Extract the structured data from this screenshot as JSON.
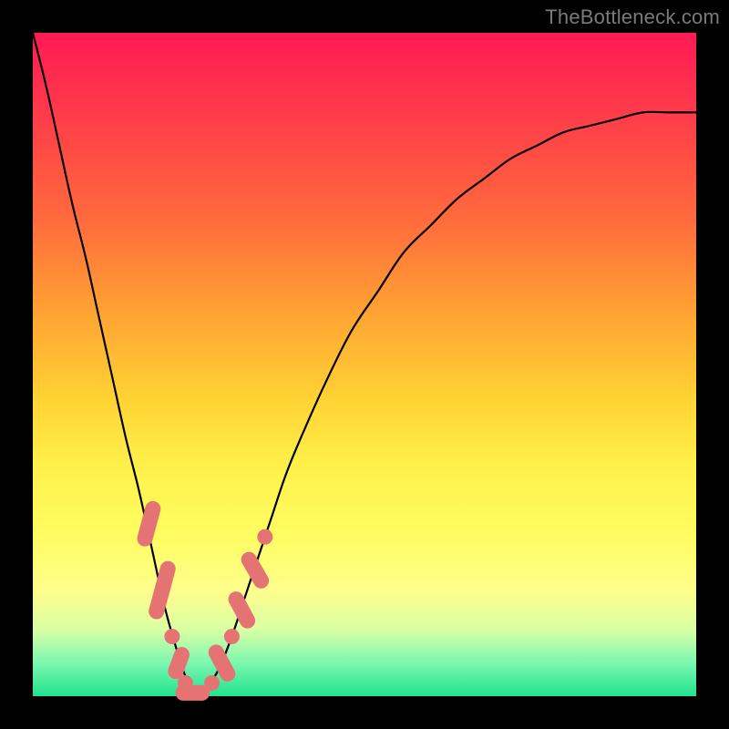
{
  "watermark": "TheBottleneck.com",
  "colors": {
    "frame": "#000000",
    "curve": "#000000",
    "marker": "#e57373",
    "gradient_stops": [
      "#ff1a55",
      "#ff3b4a",
      "#ff6a3c",
      "#ffa233",
      "#ffd233",
      "#fff04a",
      "#fffd62",
      "#fffe8c",
      "#d9ffa3",
      "#7cf7b0",
      "#20e38e"
    ]
  },
  "chart_data": {
    "type": "line",
    "title": "",
    "xlabel": "",
    "ylabel": "",
    "xlim": [
      0,
      100
    ],
    "ylim": [
      0,
      100
    ],
    "x": [
      0,
      2,
      4,
      6,
      8,
      10,
      12,
      14,
      16,
      18,
      20,
      22,
      23,
      24,
      25,
      26,
      28,
      30,
      32,
      34,
      36,
      38,
      40,
      44,
      48,
      52,
      56,
      60,
      64,
      68,
      72,
      76,
      80,
      84,
      88,
      92,
      96,
      100
    ],
    "y": [
      100,
      92,
      83,
      74,
      66,
      57,
      48,
      39,
      31,
      22,
      13,
      6,
      3,
      1,
      0,
      1,
      4,
      9,
      15,
      21,
      27,
      33,
      38,
      47,
      55,
      61,
      67,
      71,
      75,
      78,
      81,
      83,
      85,
      86,
      87,
      88,
      88,
      88
    ],
    "series_name": "bottleneck-curve",
    "markers": [
      {
        "shape": "pill",
        "x": 17.5,
        "y": 26,
        "len": 7,
        "angle": -75
      },
      {
        "shape": "pill",
        "x": 19.5,
        "y": 16,
        "len": 9,
        "angle": -75
      },
      {
        "shape": "dot",
        "x": 21,
        "y": 9
      },
      {
        "shape": "pill",
        "x": 22,
        "y": 5,
        "len": 5,
        "angle": -70
      },
      {
        "shape": "dot",
        "x": 23,
        "y": 2
      },
      {
        "shape": "pill",
        "x": 24,
        "y": 0.5,
        "len": 5,
        "angle": 0
      },
      {
        "shape": "dot",
        "x": 25.5,
        "y": 0.5
      },
      {
        "shape": "dot",
        "x": 27,
        "y": 2
      },
      {
        "shape": "pill",
        "x": 28.5,
        "y": 5,
        "len": 6,
        "angle": 62
      },
      {
        "shape": "dot",
        "x": 30,
        "y": 9
      },
      {
        "shape": "pill",
        "x": 31.5,
        "y": 13,
        "len": 6,
        "angle": 62
      },
      {
        "shape": "pill",
        "x": 33.5,
        "y": 19,
        "len": 6,
        "angle": 60
      },
      {
        "shape": "dot",
        "x": 35,
        "y": 24
      }
    ],
    "vertex_x": 24
  }
}
